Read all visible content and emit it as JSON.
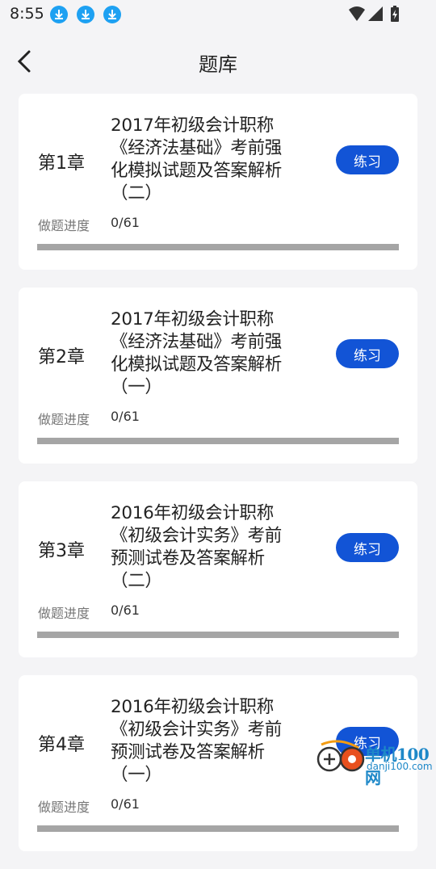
{
  "status_bar": {
    "time": "8:55",
    "download_icons": [
      "download-icon",
      "download-icon",
      "download-icon"
    ],
    "system_icons": [
      "wifi-icon",
      "signal-icon",
      "battery-charging-icon"
    ]
  },
  "header": {
    "title": "题库",
    "back_icon": "chevron-left-icon"
  },
  "cards": [
    {
      "chapter": "第1章",
      "title_lines": [
        "2017年初级会计职称",
        "《经济法基础》考前强",
        "化模拟试题及答案解析",
        "（二）"
      ],
      "button": "练习",
      "progress_label": "做题进度",
      "progress_value": "0/61",
      "progress_fraction": 0
    },
    {
      "chapter": "第2章",
      "title_lines": [
        "2017年初级会计职称",
        "《经济法基础》考前强",
        "化模拟试题及答案解析",
        "（一）"
      ],
      "button": "练习",
      "progress_label": "做题进度",
      "progress_value": "0/61",
      "progress_fraction": 0
    },
    {
      "chapter": "第3章",
      "title_lines": [
        "2016年初级会计职称",
        "《初级会计实务》考前",
        "预测试卷及答案解析",
        "（二）"
      ],
      "button": "练习",
      "progress_label": "做题进度",
      "progress_value": "0/61",
      "progress_fraction": 0
    },
    {
      "chapter": "第4章",
      "title_lines": [
        "2016年初级会计职称",
        "《初级会计实务》考前",
        "预测试卷及答案解析",
        "（一）"
      ],
      "button": "练习",
      "progress_label": "做题进度",
      "progress_value": "0/61",
      "progress_fraction": 0
    }
  ],
  "watermark": {
    "name": "单机100网",
    "url": "danji100.com"
  },
  "colors": {
    "accent": "#1254d6",
    "background": "#f4f4f6",
    "card": "#ffffff",
    "progress_track": "#a5a5a5",
    "status_download": "#1ea1f2"
  }
}
